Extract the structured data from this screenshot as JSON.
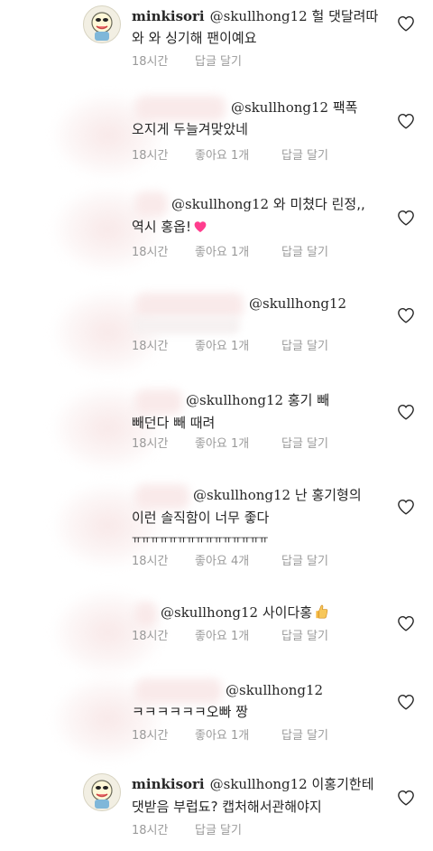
{
  "comments": [
    {
      "username": "minkisori",
      "mention": "@skullhong12",
      "line1": "헐 댓달려따",
      "line2": "와 와 싱기해  팬이예요",
      "time": "18시간",
      "likes": "",
      "reply": "답글 달기"
    },
    {
      "mention": "@skullhong12",
      "line1": "팩폭",
      "line2": "오지게 두늘겨맞았네",
      "time": "18시간",
      "likes": "좋아요 1개",
      "reply": "답글 달기"
    },
    {
      "mention": "@skullhong12",
      "line1": "와 미쳤다 린정,,",
      "line2": "역시 홍옵!",
      "time": "18시간",
      "likes": "좋아요 1개",
      "reply": "답글 달기"
    },
    {
      "mention": "@skullhong12",
      "line1": "",
      "line2": "",
      "time": "18시간",
      "likes": "좋아요 1개",
      "reply": "답글 달기"
    },
    {
      "mention": "@skullhong12",
      "line1": "홍기 빼",
      "line2": "빼던다 빼 때려",
      "time": "18시간",
      "likes": "좋아요 1개",
      "reply": "답글 달기"
    },
    {
      "mention": "@skullhong12",
      "line1": "난 홍기형의",
      "line2": "이런 솔직함이 너무 좋다",
      "line3": "ㅠㅠㅠㅠㅠㅠㅠㅠㅠㅠㅠㅠㅠㅠㅠ",
      "time": "18시간",
      "likes": "좋아요 4개",
      "reply": "답글 달기"
    },
    {
      "mention": "@skullhong12",
      "line1": "사이다홍",
      "line2": "",
      "time": "18시간",
      "likes": "좋아요 1개",
      "reply": "답글 달기"
    },
    {
      "mention": "@skullhong12",
      "line1": "",
      "line2": "ㅋㅋㅋㅋㅋㅋ오빠 짱",
      "time": "18시간",
      "likes": "좋아요 1개",
      "reply": "답글 달기"
    },
    {
      "username": "minkisori",
      "mention": "@skullhong12",
      "line1": "이홍기한테",
      "line2": "댓받음 부럽됴? 캡처해서관해야지",
      "time": "18시간",
      "likes": "",
      "reply": "답글 달기"
    }
  ],
  "icons": {
    "like": "heart-outline-icon",
    "avatar": "cartoon-avatar-icon",
    "emoji_heart": "pink-heart-emoji",
    "emoji_thumb": "thumbs-up-emoji"
  },
  "colors": {
    "text": "#262626",
    "meta": "#9a9a9a",
    "heart_outline": "#262626",
    "emoji_pink": "#ff3d8e"
  }
}
